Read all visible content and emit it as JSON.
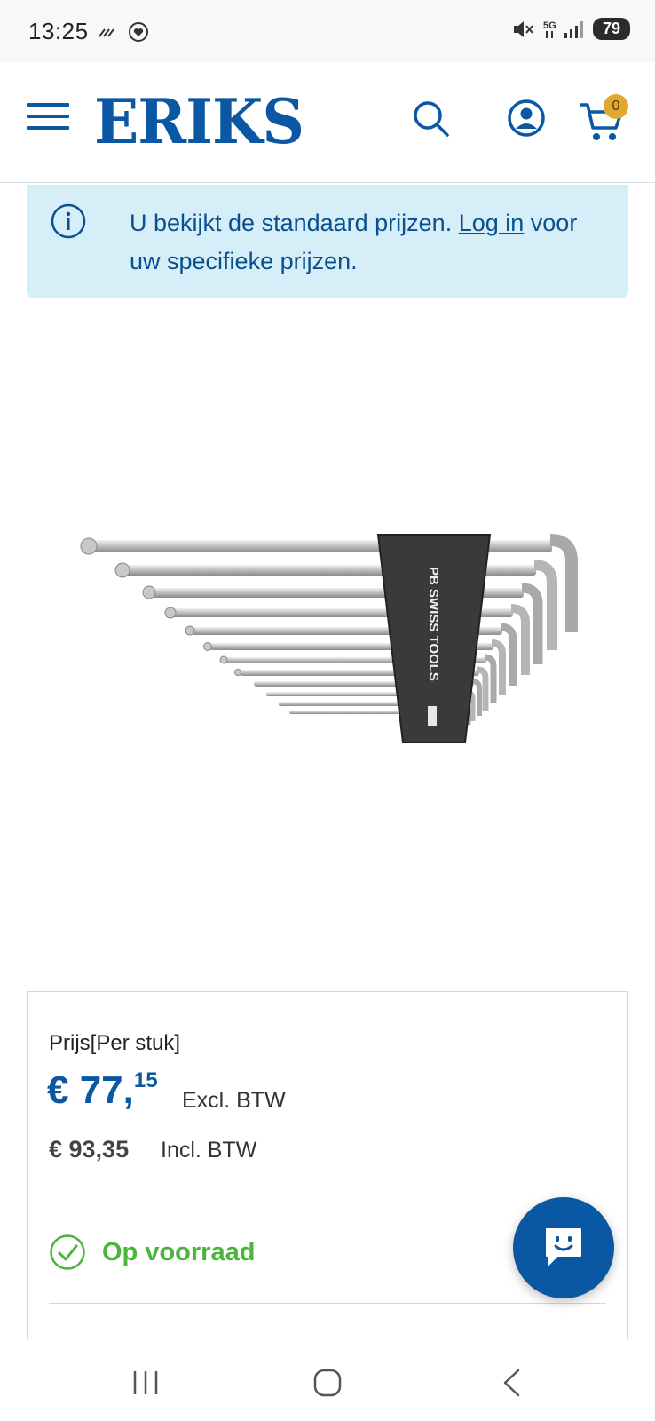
{
  "status_bar": {
    "time": "13:25",
    "battery": "79"
  },
  "header": {
    "logo_text": "ERIKS",
    "cart_count": "0",
    "brand_color": "#0a58a3"
  },
  "info_banner": {
    "text_before_link": "U bekijkt de standaard prijzen. ",
    "link_text": "Log in",
    "text_after_link": " voor uw specifieke prijzen."
  },
  "product_image": {
    "holder_text": "PB SWISS TOOLS"
  },
  "price": {
    "label": "Prijs[Per stuk]",
    "main_euros": "€ 77,",
    "main_cents": "15",
    "excl_label": "Excl. BTW",
    "incl_value": "€ 93,35",
    "incl_label": "Incl. BTW"
  },
  "stock": {
    "label": "Op voorraad",
    "color": "#49b53a"
  }
}
